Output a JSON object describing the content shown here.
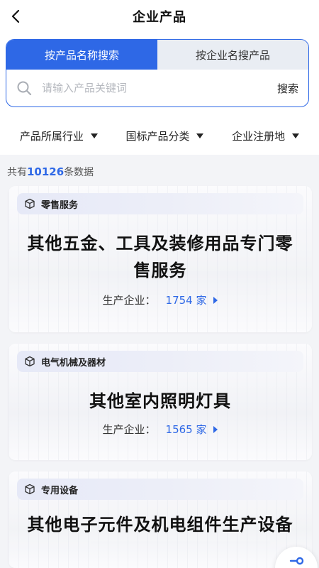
{
  "header": {
    "title": "企业产品"
  },
  "search": {
    "tabs": [
      {
        "label": "按产品名称搜索",
        "active": true
      },
      {
        "label": "按企业名搜产品",
        "active": false
      }
    ],
    "placeholder": "请输入产品关键词",
    "value": "",
    "button_label": "搜索"
  },
  "filters": [
    {
      "label": "产品所属行业"
    },
    {
      "label": "国标产品分类"
    },
    {
      "label": "企业注册地"
    }
  ],
  "summary": {
    "prefix": "共有",
    "count": "10126",
    "suffix": "条数据"
  },
  "cards": [
    {
      "tag": "零售服务",
      "title": "其他五金、工具及装修用品专门零售服务",
      "meta_label": "生产企业：",
      "meta_value": "1754 家"
    },
    {
      "tag": "电气机械及器材",
      "title": "其他室内照明灯具",
      "meta_label": "生产企业：",
      "meta_value": "1565 家"
    },
    {
      "tag": "专用设备",
      "title": "其他电子元件及机电组件生产设备",
      "meta_label": "",
      "meta_value": ""
    }
  ],
  "colors": {
    "accent": "#2e68e6",
    "tab_inactive": "#e9edf3",
    "background": "#f3f4f7"
  }
}
